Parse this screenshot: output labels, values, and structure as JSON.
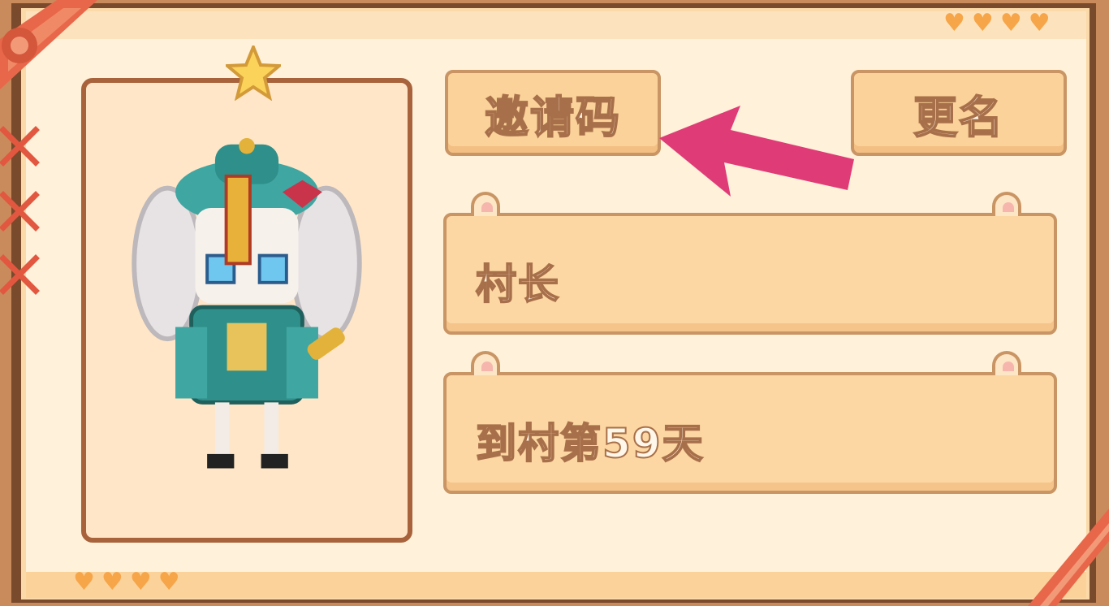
{
  "buttons": {
    "invite_code": "邀请码",
    "rename": "更名"
  },
  "profile": {
    "title": "村长",
    "days_in_village": "到村第59天"
  },
  "colors": {
    "accent_arrow": "#df3c77",
    "panel": "#fbd29a",
    "border": "#a8633c"
  },
  "decor": {
    "top_hearts": 4,
    "bottom_hearts": 4,
    "icons": [
      "star-icon",
      "heart-icon",
      "bow-ribbon",
      "arrow-pointer"
    ]
  }
}
